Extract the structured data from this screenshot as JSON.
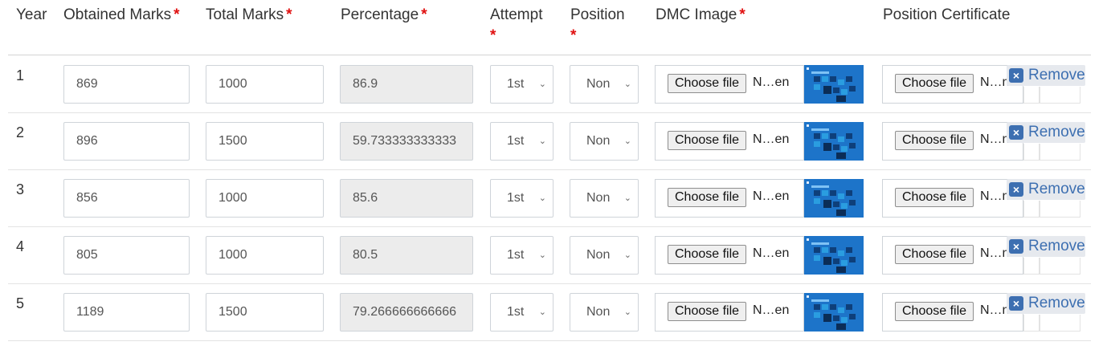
{
  "headers": {
    "year": "Year",
    "obtained_marks": "Obtained Marks",
    "total_marks": "Total Marks",
    "percentage": "Percentage",
    "attempt": "Attempt",
    "position": "Position",
    "dmc_image": "DMC Image",
    "position_certificate": "Position Certificate",
    "required_mark": "*"
  },
  "rows": [
    {
      "year": "1",
      "obtained": "869",
      "total": "1000",
      "percentage": "86.9",
      "attempt": "1st",
      "position": "Non",
      "dmc_button": "Choose file",
      "dmc_filename": "N…en",
      "cert_button": "Choose file",
      "cert_filename": "N…n",
      "remove_label": "Remove"
    },
    {
      "year": "2",
      "obtained": "896",
      "total": "1500",
      "percentage": "59.733333333333",
      "attempt": "1st",
      "position": "Non",
      "dmc_button": "Choose file",
      "dmc_filename": "N…en",
      "cert_button": "Choose file",
      "cert_filename": "N…n",
      "remove_label": "Remove"
    },
    {
      "year": "3",
      "obtained": "856",
      "total": "1000",
      "percentage": "85.6",
      "attempt": "1st",
      "position": "Non",
      "dmc_button": "Choose file",
      "dmc_filename": "N…en",
      "cert_button": "Choose file",
      "cert_filename": "N…n",
      "remove_label": "Remove"
    },
    {
      "year": "4",
      "obtained": "805",
      "total": "1000",
      "percentage": "80.5",
      "attempt": "1st",
      "position": "Non",
      "dmc_button": "Choose file",
      "dmc_filename": "N…en",
      "cert_button": "Choose file",
      "cert_filename": "N…n",
      "remove_label": "Remove"
    },
    {
      "year": "5",
      "obtained": "1189",
      "total": "1500",
      "percentage": "79.266666666666",
      "attempt": "1st",
      "position": "Non",
      "dmc_button": "Choose file",
      "dmc_filename": "N…en",
      "cert_button": "Choose file",
      "cert_filename": "N…n",
      "remove_label": "Remove"
    }
  ],
  "icons": {
    "remove": "close-x-icon",
    "select_arrow": "chevron-down-icon",
    "dmc_preview": "image-thumbnail"
  },
  "colors": {
    "required": "#e01010",
    "remove_accent": "#3d6fb1",
    "thumbnail": "#1d74c9",
    "readonly_bg": "#ececec"
  }
}
